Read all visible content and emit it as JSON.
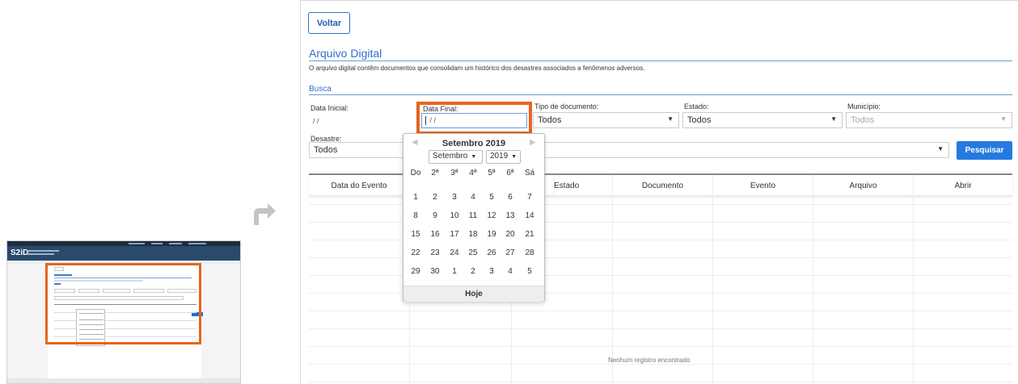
{
  "page": {
    "back_label": "Voltar",
    "section_title": "Arquivo Digital",
    "description": "O arquivo digital contêm documentos que consolidam um histórico dos desastres associados a fenômenos adversos.",
    "subsection_title": "Busca"
  },
  "thumbnail": {
    "logo": "S2iD"
  },
  "form": {
    "data_inicial": {
      "label": "Data Inicial:",
      "value": " /  /"
    },
    "data_final": {
      "label": "Data Final:",
      "value": " /  /"
    },
    "tipo_documento": {
      "label": "Tipo de documento:",
      "value": "Todos"
    },
    "estado": {
      "label": "Estado:",
      "value": "Todos"
    },
    "municipio": {
      "label": "Município:",
      "value": "Todos"
    },
    "desastre": {
      "label": "Desastre:",
      "value": "Todos"
    },
    "search_label": "Pesquisar"
  },
  "table": {
    "columns": [
      "Data do Evento",
      "Estado",
      "Documento",
      "Evento",
      "Arquivo",
      "Abrir"
    ],
    "empty_message": "Nenhum registro encontrado"
  },
  "datepicker": {
    "title": "Setembro 2019",
    "month_select": "Setembro",
    "year_select": "2019",
    "weekdays": [
      "Do",
      "2ª",
      "3ª",
      "4ª",
      "5ª",
      "6ª",
      "Sá"
    ],
    "weeks": [
      [
        "1",
        "2",
        "3",
        "4",
        "5",
        "6",
        "7"
      ],
      [
        "8",
        "9",
        "10",
        "11",
        "12",
        "13",
        "14"
      ],
      [
        "15",
        "16",
        "17",
        "18",
        "19",
        "20",
        "21"
      ],
      [
        "22",
        "23",
        "24",
        "25",
        "26",
        "27",
        "28"
      ],
      [
        "29",
        "30",
        "1",
        "2",
        "3",
        "4",
        "5"
      ]
    ],
    "today_label": "Hoje"
  },
  "colors": {
    "highlight": "#e8631e",
    "accent": "#2e6fcc",
    "button": "#2579e0"
  }
}
